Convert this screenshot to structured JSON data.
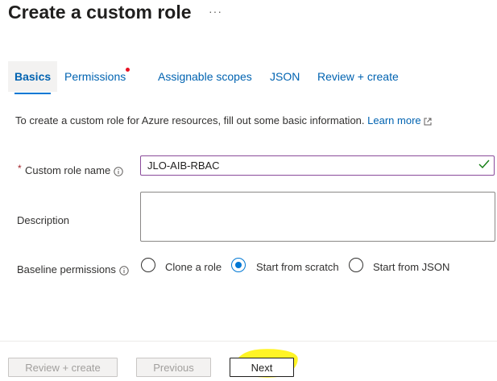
{
  "page": {
    "title": "Create a custom role",
    "more_label": "···"
  },
  "tabs": [
    {
      "label": "Basics",
      "active": true
    },
    {
      "label": "Permissions",
      "active": false,
      "has_alert": true
    },
    {
      "label": "Assignable scopes",
      "active": false
    },
    {
      "label": "JSON",
      "active": false
    },
    {
      "label": "Review + create",
      "active": false
    }
  ],
  "intro": {
    "text": "To create a custom role for Azure resources, fill out some basic information.",
    "link_label": "Learn more"
  },
  "form": {
    "role_name": {
      "label": "Custom role name",
      "required_mark": "*",
      "value": "JLO-AIB-RBAC"
    },
    "description": {
      "label": "Description",
      "value": ""
    },
    "baseline": {
      "label": "Baseline permissions",
      "options": [
        {
          "label": "Clone a role",
          "selected": false
        },
        {
          "label": "Start from scratch",
          "selected": true
        },
        {
          "label": "Start from JSON",
          "selected": false
        }
      ]
    }
  },
  "footer": {
    "review_label": "Review + create",
    "previous_label": "Previous",
    "next_label": "Next"
  },
  "colors": {
    "accent": "#0078d4",
    "link": "#0063b1",
    "alert_dot": "#e81123",
    "valid_check": "#107c10",
    "input_focus_border": "#8a4b9a",
    "annotation_highlight": "#fff200"
  }
}
